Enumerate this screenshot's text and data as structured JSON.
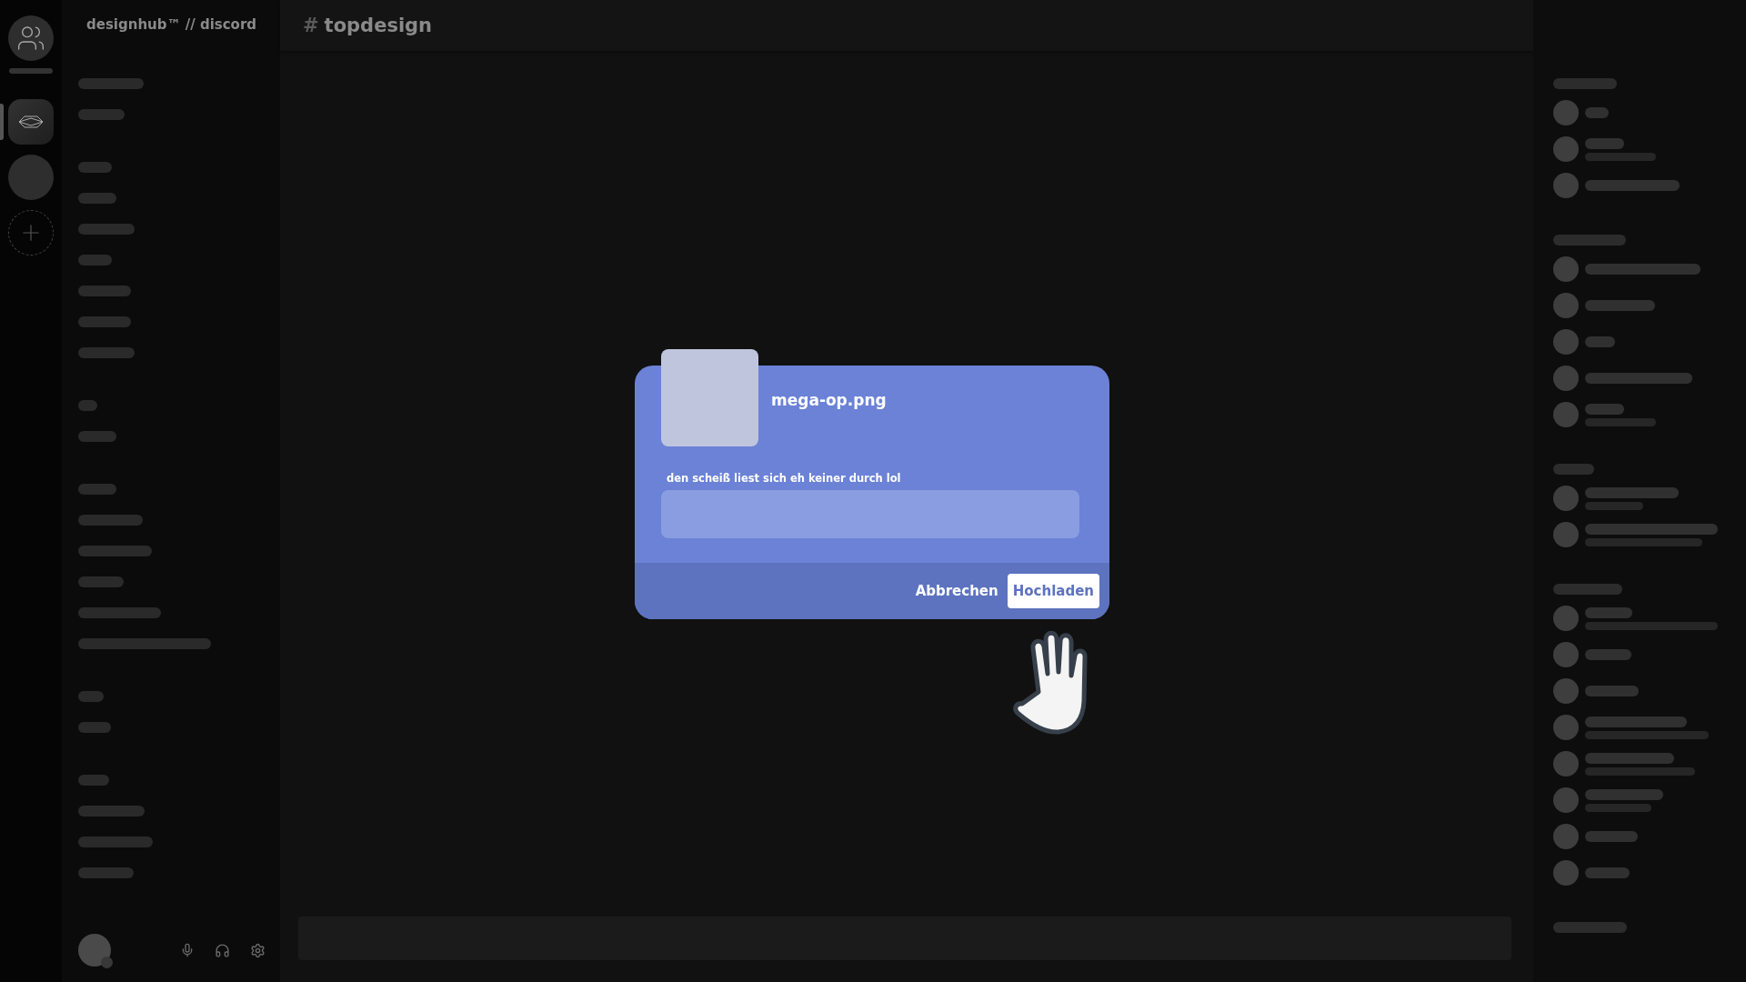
{
  "servers": [
    {
      "kind": "home",
      "selected": false
    },
    {
      "kind": "logo",
      "selected": true
    },
    {
      "kind": "plain",
      "selected": false
    },
    {
      "kind": "add",
      "selected": false
    }
  ],
  "server_name": "designhub™ // discord",
  "channel": {
    "hash": "#",
    "name": "topdesign"
  },
  "upload_dialog": {
    "filename": "mega-op.png",
    "label": "den scheiß liest sich eh keiner durch lol",
    "buttons": [
      {
        "kind": "cancel",
        "label": "Abbrechen"
      },
      {
        "kind": "primary",
        "label": "Hochladen"
      }
    ]
  }
}
